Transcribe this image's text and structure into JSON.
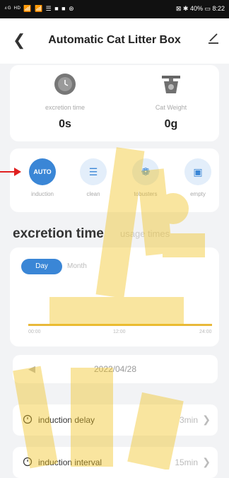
{
  "status": {
    "left": "⁴ᴳ ᴴᴰ 📶 📶 ☰ ■ ■ ⊛",
    "right": "⊠ ✱ 40% ▭ 8:22"
  },
  "header": {
    "title": "Automatic Cat Litter Box"
  },
  "stats": [
    {
      "label": "excretion time",
      "value": "0s",
      "icon": "clock-icon"
    },
    {
      "label": "Cat Weight",
      "value": "0g",
      "icon": "scale-icon"
    }
  ],
  "modes": [
    {
      "label": "induction",
      "icon": "AUTO"
    },
    {
      "label": "clean",
      "icon": "sweep-icon"
    },
    {
      "label": "tobusters",
      "icon": "leaf-icon"
    },
    {
      "label": "empty",
      "icon": "bin-icon"
    }
  ],
  "section": {
    "title": "excretion time",
    "alt_tab": "usage times"
  },
  "chart": {
    "tab_active": "Day",
    "tab_inactive": "Month",
    "x_ticks": [
      "00:00",
      "12:00",
      "24:00"
    ]
  },
  "date_bar": {
    "date": "2022/04/28"
  },
  "settings": [
    {
      "label": "induction delay",
      "value": "3min"
    },
    {
      "label": "induction interval",
      "value": "15min"
    }
  ],
  "colors": {
    "accent": "#3a86d6",
    "watermark": "#f1c21b"
  }
}
